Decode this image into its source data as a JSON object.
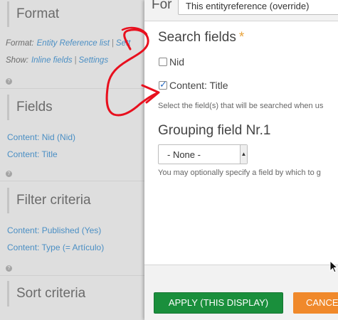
{
  "background": {
    "sections": [
      {
        "title": "Format"
      },
      {
        "title": "Fields"
      },
      {
        "title": "Filter criteria"
      },
      {
        "title": "Sort criteria"
      }
    ],
    "format_line": {
      "label": "Format:",
      "value": "Entity Reference list",
      "sep": "|",
      "link": "Sett"
    },
    "show_line": {
      "label": "Show:",
      "value": "Inline fields",
      "sep": "|",
      "link": "Settings"
    },
    "help_glyph": "?",
    "fields": [
      "Content: Nid (Nid)",
      "Content: Title"
    ],
    "filters": [
      "Content: Published (Yes)",
      "Content: Type (= Artículo)"
    ]
  },
  "modal": {
    "for_label": "For",
    "for_value": "This entityreference (override)",
    "search_fields": {
      "heading": "Search fields",
      "required_mark": "*",
      "options": [
        {
          "label": "Nid",
          "checked": false
        },
        {
          "label": "Content: Title",
          "checked": true
        }
      ],
      "description": "Select the field(s) that will be searched when us"
    },
    "grouping": {
      "heading": "Grouping field Nr.1",
      "selected": "- None -",
      "description": "You may optionally specify a field by which to g"
    },
    "buttons": {
      "apply": "APPLY (THIS DISPLAY)",
      "cancel": "CANCE"
    }
  },
  "colors": {
    "apply": "#1a8f3c",
    "cancel": "#f0892b",
    "link": "#4b8fc4",
    "required": "#e8a33c",
    "annotation": "#e8101e"
  }
}
